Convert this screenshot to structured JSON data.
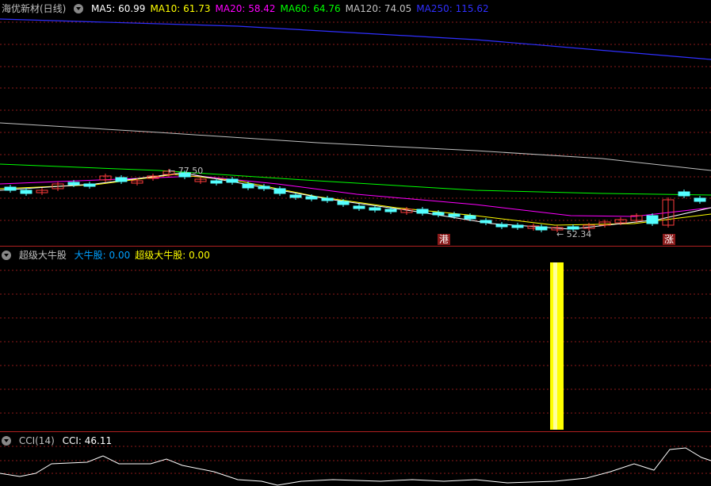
{
  "main": {
    "title": "海优新材(日线)",
    "ma": [
      {
        "label": "MA5: 60.99",
        "color": "#ffffff"
      },
      {
        "label": "MA10: 61.73",
        "color": "#ffff00"
      },
      {
        "label": "MA20: 58.42",
        "color": "#ff00ff"
      },
      {
        "label": "MA60: 64.76",
        "color": "#00ff00"
      },
      {
        "label": "MA120: 74.05",
        "color": "#c0c0c0"
      },
      {
        "label": "MA250: 115.62",
        "color": "#2f2fff"
      }
    ],
    "high_label": "77.50",
    "low_label": "52.34",
    "tag_gang": "港",
    "tag_zhang": "涨"
  },
  "indicator": {
    "title": "超级大牛股",
    "items": [
      {
        "label": "大牛股: 0.00",
        "color": "#00a0ff"
      },
      {
        "label": "超级大牛股: 0.00",
        "color": "#ffff00"
      }
    ]
  },
  "cci": {
    "title": "CCI(14)",
    "value": "CCI: 46.11"
  },
  "colors": {
    "up": "#ff3b3b",
    "down": "#54ffff",
    "grid": "#8b1a1a",
    "bar": "#ffff00"
  },
  "icons": [
    "collapse-triangle-icon"
  ]
}
